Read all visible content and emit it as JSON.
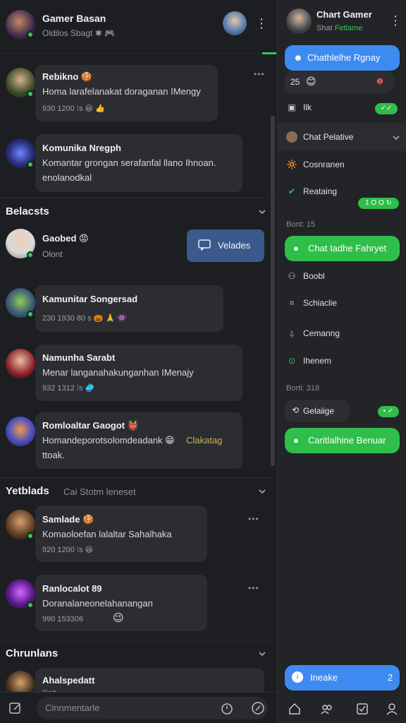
{
  "header": {
    "title": "Gamer Basan",
    "subtitle": "Oldilos Sbagt  ✱ 🎮"
  },
  "messages": [
    {
      "name": "Rebikno 🍪",
      "text": "Homa larafelanakat doraganan IMengy",
      "meta": "930 1200 ⁞s 😆 👍",
      "more": "•••"
    },
    {
      "name": "Komunika Nregph",
      "text": "Komantar grongan serafanfal llano Ihnoan.",
      "text2": "enolanodkal"
    },
    {
      "name": "Kamunitar Songersad",
      "meta": "230 1930 80 s  🎃 🙏 👾"
    },
    {
      "name": "Namunha Sarabt",
      "text": "Menar langanahakunganhan IMenajy",
      "meta": "932 1312 ⁞s 🥏"
    },
    {
      "name": "Romloaltar Gaogot 👹",
      "text": "Homandeporotsolomdeadank 😁",
      "text_tail": "Clakatag",
      "text2": "ttoak."
    },
    {
      "name": "Samlade 🍪",
      "text": "Komaoloefan lalaltar Sahalhaka",
      "meta": "920 1200 ⁞s 😆",
      "more": "•••"
    },
    {
      "name": "Ranlocalot 89",
      "text": "Doranalaneonelahanangan",
      "meta": "990 153306",
      "emoji": "😉",
      "more": "•••"
    },
    {
      "name": "Ahalspedatt",
      "meta": "Coit"
    }
  ],
  "sections": [
    {
      "title": "Belacsts"
    },
    {
      "title": "Yetblads",
      "sub": "Cai Stotm leneset"
    },
    {
      "title": "Chrunlans"
    }
  ],
  "featured": {
    "name": "Gaobed 😡",
    "status": "Olont",
    "button_label": "Velades"
  },
  "composer": {
    "placeholder": "Cinnmentarle"
  },
  "right": {
    "title": "Chart Gamer",
    "subtitle_prefix": "Shat",
    "subtitle_status": "Fetlame",
    "top_button": "Chathlelhe Rgnay",
    "top_card_left": "25",
    "top_card_badge": "❷",
    "row_a_label": "Ilk",
    "row_a_badge": "✓✓",
    "group_title": "Chat Pelative",
    "items": [
      {
        "icon": "🔆",
        "label": "Cosnranen"
      },
      {
        "icon": "✔",
        "label": "Reataing",
        "badge": "1 O O ↻"
      }
    ],
    "head1": "Bont: 15",
    "green_btn1": "Chat Iadhe Fahryet",
    "list2": [
      {
        "icon": "⚇",
        "label": "Boobl"
      },
      {
        "icon": "⌗",
        "label": "Schiaclie"
      },
      {
        "icon": "⍙",
        "label": "Cemanng"
      },
      {
        "icon": "⊙",
        "label": "Ihenem"
      }
    ],
    "head2": "Borti: 318",
    "dark_pill": "Gelaiige",
    "dark_pill_badge": "• ✓",
    "green_btn2": "Caritlalhine Benuar",
    "bottom_button": "Ineake",
    "bottom_button_badge": "2"
  },
  "colors": {
    "accent_blue": "#3d8bf0",
    "accent_green": "#2fbe4a",
    "panel_bg": "#1d1e21"
  }
}
